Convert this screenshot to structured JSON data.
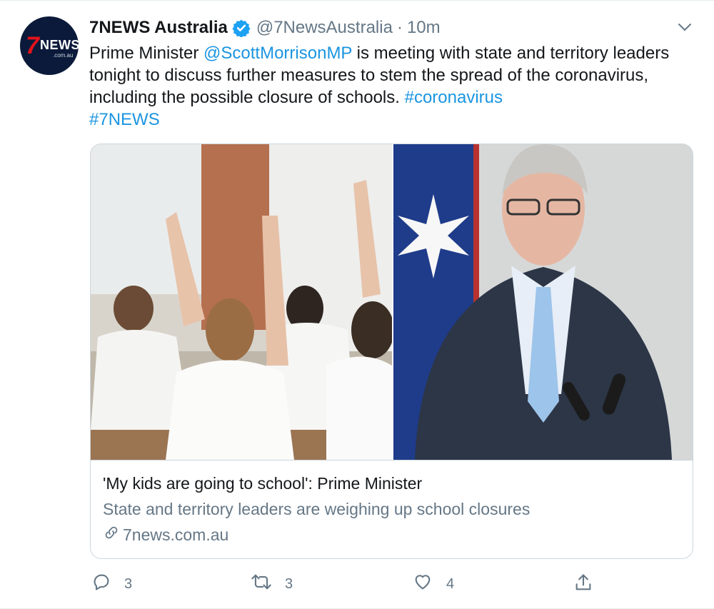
{
  "account": {
    "display_name": "7NEWS Australia",
    "handle": "@7NewsAustralia",
    "separator": "·",
    "time": "10m",
    "avatar_logo_number": "7",
    "avatar_logo_word": "NEWS",
    "avatar_logo_domain": ".com.au"
  },
  "tweet": {
    "text_1": "Prime Minister ",
    "mention": "@ScottMorrisonMP",
    "text_2": " is meeting with state and territory leaders tonight to discuss further measures to stem the spread of the coronavirus, including the possible closure of schools. ",
    "hashtag_1": "#coronavirus",
    "hashtag_2": "#7NEWS"
  },
  "card": {
    "title": "'My kids are going to school': Prime Minister",
    "description": "State and territory leaders are weighing up school closures",
    "domain": "7news.com.au"
  },
  "actions": {
    "reply_count": "3",
    "retweet_count": "3",
    "like_count": "4"
  },
  "colors": {
    "link": "#1b95e0",
    "secondary": "#657786",
    "verified": "#1da1f2"
  },
  "icons": [
    "verified-badge-icon",
    "chevron-down-icon",
    "link-icon",
    "reply-icon",
    "retweet-icon",
    "like-icon",
    "share-icon"
  ]
}
